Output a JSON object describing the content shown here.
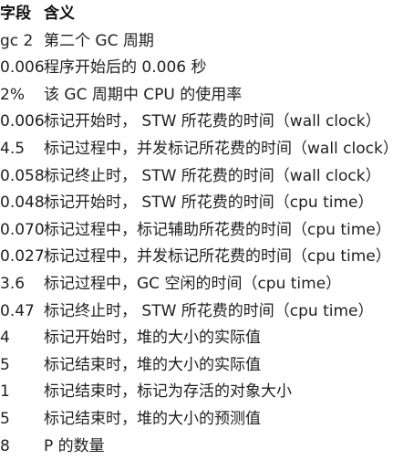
{
  "table": {
    "headers": {
      "field": "字段",
      "meaning": "含义"
    },
    "rows": [
      {
        "field": "gc 2",
        "meaning": "第二个 GC 周期"
      },
      {
        "field": "0.006",
        "meaning": "程序开始后的 0.006 秒"
      },
      {
        "field": "2%",
        "meaning": "该 GC 周期中 CPU 的使用率"
      },
      {
        "field": "0.006",
        "meaning": "标记开始时， STW 所花费的时间（wall clock）"
      },
      {
        "field": "4.5",
        "meaning": "标记过程中，并发标记所花费的时间（wall clock）"
      },
      {
        "field": "0.058",
        "meaning": "标记终止时， STW 所花费的时间（wall clock）"
      },
      {
        "field": "0.048",
        "meaning": "标记开始时， STW 所花费的时间（cpu time）"
      },
      {
        "field": "0.070",
        "meaning": "标记过程中，标记辅助所花费的时间（cpu time）"
      },
      {
        "field": "0.027",
        "meaning": "标记过程中，并发标记所花费的时间（cpu time）"
      },
      {
        "field": "3.6",
        "meaning": "标记过程中，GC 空闲的时间（cpu time）"
      },
      {
        "field": "0.47",
        "meaning": "标记终止时， STW 所花费的时间（cpu time）"
      },
      {
        "field": "4",
        "meaning": "标记开始时，堆的大小的实际值"
      },
      {
        "field": "5",
        "meaning": "标记结束时，堆的大小的实际值"
      },
      {
        "field": "1",
        "meaning": "标记结束时，标记为存活的对象大小"
      },
      {
        "field": "5",
        "meaning": "标记结束时，堆的大小的预测值"
      },
      {
        "field": "8",
        "meaning": "P 的数量"
      }
    ]
  }
}
